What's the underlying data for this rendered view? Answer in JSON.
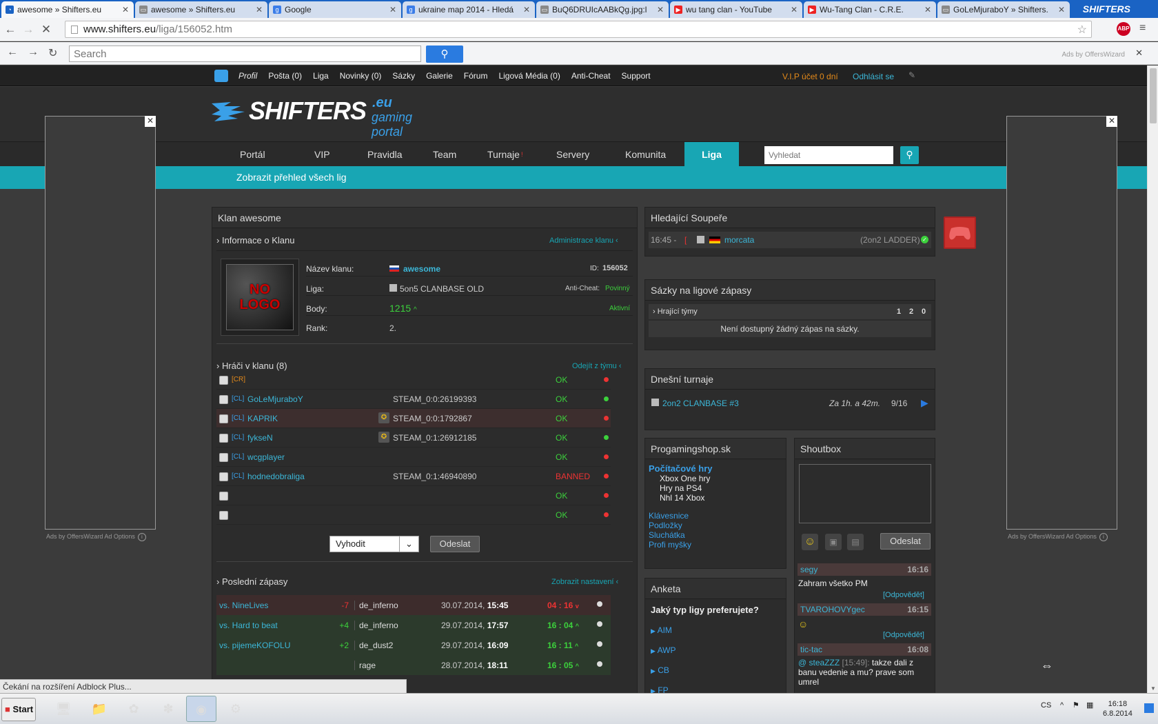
{
  "browser": {
    "tabs": [
      {
        "title": "awesome » Shifters.eu",
        "active": true,
        "icon": "loading-icon"
      },
      {
        "title": "awesome » Shifters.eu",
        "active": false,
        "icon": "page-icon"
      },
      {
        "title": "Google",
        "active": false,
        "icon": "google-icon"
      },
      {
        "title": "ukraine map 2014 - Hledá",
        "active": false,
        "icon": "google-icon"
      },
      {
        "title": "BuQ6DRUIcAABkQg.jpg:l",
        "active": false,
        "icon": "page-icon"
      },
      {
        "title": "wu tang clan - YouTube",
        "active": false,
        "icon": "youtube-icon"
      },
      {
        "title": "Wu-Tang Clan - C.R.E.",
        "active": false,
        "icon": "youtube-icon"
      },
      {
        "title": "GoLeMjuraboY » Shifters.",
        "active": false,
        "icon": "page-icon"
      }
    ],
    "brand": "SHIFTERS",
    "url_host": "www.shifters.eu",
    "url_path": "/liga/156052.htm",
    "abp_label": "ABP",
    "search_placeholder": "Search",
    "ads_by": "Ads by OffersWizard"
  },
  "topnav": {
    "items": [
      "Profil",
      "Pošta (0)",
      "Liga",
      "Novinky (0)",
      "Sázky",
      "Galerie",
      "Fórum",
      "Ligová Média (0)",
      "Anti-Cheat",
      "Support"
    ],
    "vip": "V.I.P účet 0 dní",
    "logout": "Odhlásit se"
  },
  "site": {
    "logo_main": "SHIFTERS",
    "logo_eu": ".eu",
    "logo_sub": "gaming portal"
  },
  "mainnav": {
    "items": [
      "Portál",
      "VIP",
      "Pravidla",
      "Team",
      "Turnaje",
      "Servery",
      "Komunita",
      "Liga"
    ],
    "turnaje_badge": "!",
    "search_placeholder": "Vyhledat",
    "sub_link": "Zobrazit přehled všech lig"
  },
  "ads": {
    "label": "Ads by OffersWizard Ad Options"
  },
  "clan": {
    "title": "Klan awesome",
    "info_header": "Informace o Klanu",
    "admin_link": "Administrace klanu",
    "nologo": [
      "NO",
      "LOGO"
    ],
    "name_label": "Název klanu:",
    "name": "awesome",
    "id_label": "ID:",
    "id": "156052",
    "league_label": "Liga:",
    "league": "5on5 CLANBASE OLD",
    "anticheat_label": "Anti-Cheat:",
    "anticheat": "Povinný",
    "points_label": "Body:",
    "points": "1215",
    "status": "Aktivní",
    "rank_label": "Rank:",
    "rank": "2.",
    "players_header": "Hráči v klanu (8)",
    "leave_link": "Odejít z týmu",
    "players": [
      {
        "tag": "[CR]",
        "name": "",
        "steam": "",
        "status": "OK",
        "status_color": "#3cd13c",
        "dot": "#e33",
        "medal": false,
        "highlight": false,
        "tag_color": "#e48a1a"
      },
      {
        "tag": "[CL]",
        "name": "GoLeMjuraboY",
        "steam": "STEAM_0:0:26199393",
        "status": "OK",
        "status_color": "#3cd13c",
        "dot": "#3cd13c",
        "medal": false,
        "highlight": false,
        "tag_color": "#3aa0e8"
      },
      {
        "tag": "[CL]",
        "name": "KAPRIK",
        "steam": "STEAM_0:0:1792867",
        "status": "OK",
        "status_color": "#3cd13c",
        "dot": "#e33",
        "medal": true,
        "highlight": true,
        "tag_color": "#3aa0e8"
      },
      {
        "tag": "[CL]",
        "name": "fykseN",
        "steam": "STEAM_0:1:26912185",
        "status": "OK",
        "status_color": "#3cd13c",
        "dot": "#3cd13c",
        "medal": true,
        "highlight": false,
        "tag_color": "#3aa0e8"
      },
      {
        "tag": "[CL]",
        "name": "wcgplayer",
        "steam": "",
        "status": "OK",
        "status_color": "#3cd13c",
        "dot": "#e33",
        "medal": false,
        "highlight": false,
        "tag_color": "#3aa0e8"
      },
      {
        "tag": "[CL]",
        "name": "hodnedobraliga",
        "steam": "STEAM_0:1:46940890",
        "status": "BANNED",
        "status_color": "#e33",
        "dot": "#e33",
        "medal": false,
        "highlight": false,
        "tag_color": "#3aa0e8"
      },
      {
        "tag": "",
        "name": "",
        "steam": "",
        "status": "OK",
        "status_color": "#3cd13c",
        "dot": "#e33",
        "medal": false,
        "highlight": false,
        "tag_color": "#3aa0e8"
      },
      {
        "tag": "",
        "name": "",
        "steam": "",
        "status": "OK",
        "status_color": "#3cd13c",
        "dot": "#e33",
        "medal": false,
        "highlight": false,
        "tag_color": "#3aa0e8"
      }
    ],
    "action_select": "Vyhodit",
    "submit": "Odeslat",
    "matches_header": "Poslední zápasy",
    "settings_link": "Zobrazit nastavení",
    "matches": [
      {
        "vs": "vs. NineLives",
        "pts": "-7",
        "map": "de_inferno",
        "date": "30.07.2014,",
        "time": "15:45",
        "score": "04 : 16",
        "result": "lose"
      },
      {
        "vs": "vs. Hard to beat",
        "pts": "+4",
        "map": "de_inferno",
        "date": "29.07.2014,",
        "time": "17:57",
        "score": "16 : 04",
        "result": "win"
      },
      {
        "vs": "vs. pijemeKOFOLU",
        "pts": "+2",
        "map": "de_dust2",
        "date": "29.07.2014,",
        "time": "16:09",
        "score": "16 : 11",
        "result": "win"
      },
      {
        "vs": "",
        "pts": "",
        "map": "rage",
        "date": "28.07.2014,",
        "time": "18:11",
        "score": "16 : 05",
        "result": "win"
      }
    ]
  },
  "opponents": {
    "title": "Hledající Soupeře",
    "time": "16:45 -",
    "flag": "[",
    "name": "morcata",
    "league": "(2on2 LADDER)"
  },
  "bets": {
    "title": "Sázky na ligové zápasy",
    "teams_label": "Hrající týmy",
    "cols": [
      "1",
      "2",
      "0"
    ],
    "empty": "Není dostupný žádný zápas na sázky."
  },
  "tournaments": {
    "title": "Dnešní turnaje",
    "name": "2on2 CLANBASE #3",
    "time": "Za 1h. a 42m.",
    "slots": "9/16"
  },
  "shop": {
    "title": "Progamingshop.sk",
    "items": [
      {
        "label": "Počítačové hry",
        "bold": true,
        "indent": false
      },
      {
        "label": "Xbox One hry",
        "bold": false,
        "indent": true
      },
      {
        "label": "Hry na PS4",
        "bold": false,
        "indent": true
      },
      {
        "label": "Nhl 14 Xbox",
        "bold": false,
        "indent": true
      },
      {
        "label": "",
        "bold": false,
        "indent": false
      },
      {
        "label": "Klávesnice",
        "bold": false,
        "indent": false
      },
      {
        "label": "Podložky",
        "bold": false,
        "indent": false
      },
      {
        "label": "Sluchátka",
        "bold": false,
        "indent": false
      },
      {
        "label": "Profi myšky",
        "bold": false,
        "indent": false
      }
    ]
  },
  "poll": {
    "title": "Anketa",
    "question": "Jaký typ ligy preferujete?",
    "options": [
      "AIM",
      "AWP",
      "CB",
      "FP"
    ]
  },
  "shoutbox": {
    "title": "Shoutbox",
    "send": "Odeslat",
    "messages": [
      {
        "user": "segy",
        "time": "16:16",
        "text": "Zahram všetko PM",
        "reply": "[Odpovědět]"
      },
      {
        "user": "TVAROHOVYgec",
        "time": "16:15",
        "text": "",
        "reply": "[Odpovědět]"
      },
      {
        "user": "tic-tac",
        "time": "16:08",
        "text": "takze dali z banu vedenie a mu? prave som umrel",
        "quote_user": "steaZZZ",
        "quote_time": "[15:49]:",
        "reply": ""
      }
    ]
  },
  "status_bar": "Čekání na rozšíření Adblock Plus...",
  "taskbar": {
    "start": "Start",
    "lang": "CS",
    "time": "16:18",
    "date": "6.8.2014"
  }
}
